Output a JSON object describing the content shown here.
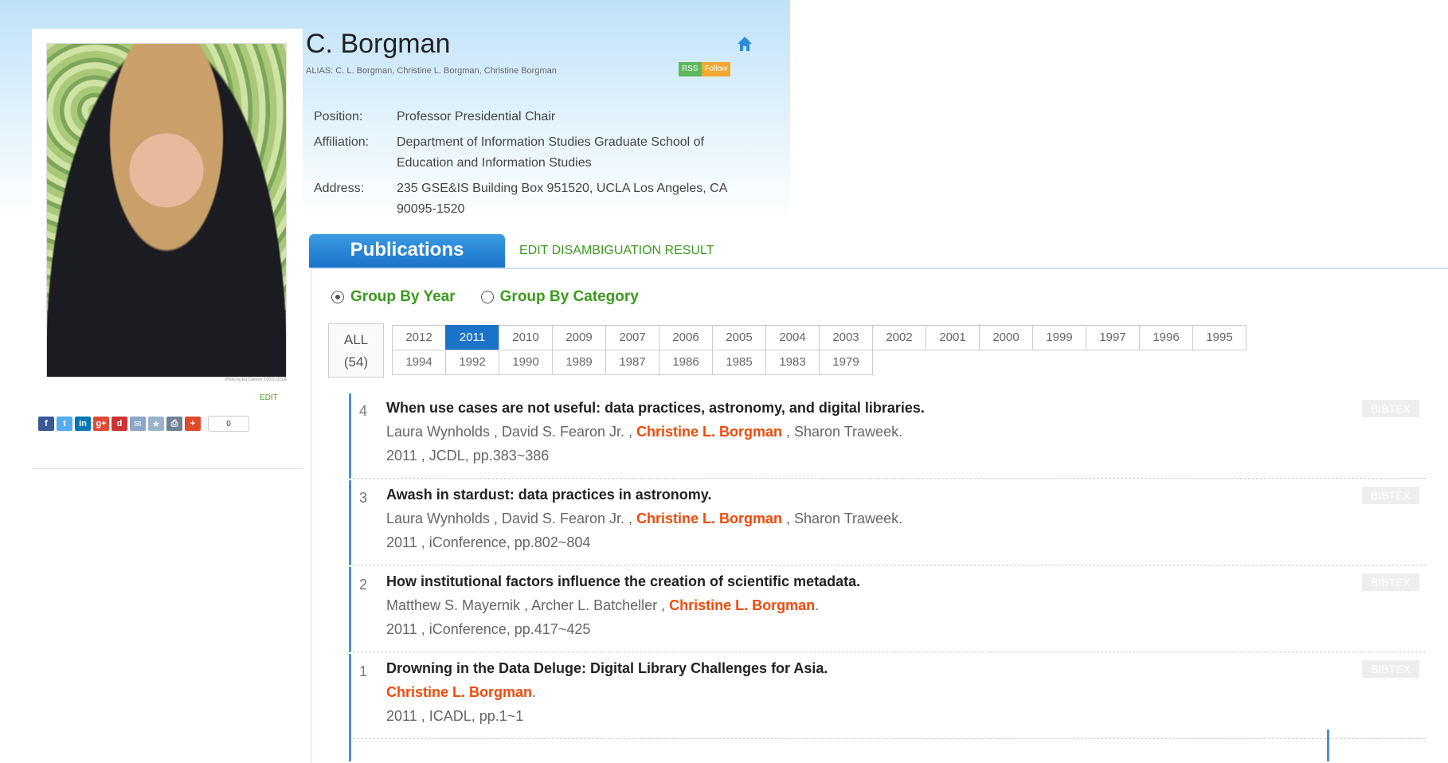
{
  "profile": {
    "name": "C. Borgman",
    "alias": "ALIAS: C. L. Borgman, Christine L. Borgman, Christine Borgman",
    "photo_credit": "Photo by Ed Carreon ©2011 UCLA",
    "edit_label": "EDIT",
    "badges": {
      "rss": "RSS",
      "follow": "Follow"
    },
    "position_label": "Position:",
    "position": "Professor Presidential Chair",
    "affiliation_label": "Affiliation:",
    "affiliation": "Department of Information Studies Graduate School of Education and Information Studies",
    "address_label": "Address:",
    "address": "235 GSE&IS Building Box 951520, UCLA Los Angeles, CA 90095-1520",
    "share_count": "0"
  },
  "share_icons": [
    {
      "icon": "facebook-icon",
      "glyph": "f",
      "color": "#3b5998"
    },
    {
      "icon": "twitter-icon",
      "glyph": "t",
      "color": "#55acee"
    },
    {
      "icon": "linkedin-icon",
      "glyph": "in",
      "color": "#0077b5"
    },
    {
      "icon": "google-plus-icon",
      "glyph": "g+",
      "color": "#dd4b39"
    },
    {
      "icon": "delicious-icon",
      "glyph": "d",
      "color": "#cc3333"
    },
    {
      "icon": "email-icon",
      "glyph": "✉",
      "color": "#8aa7c7"
    },
    {
      "icon": "bookmark-icon",
      "glyph": "★",
      "color": "#9bb3c9"
    },
    {
      "icon": "print-icon",
      "glyph": "⎙",
      "color": "#6f8194"
    },
    {
      "icon": "more-share-icon",
      "glyph": "+",
      "color": "#e04b2b"
    }
  ],
  "publications": {
    "tab_label": "Publications",
    "edit_disambiguation": "EDIT DISAMBIGUATION RESULT",
    "group_by_year": "Group By Year",
    "group_by_category": "Group By Category",
    "all_label": "ALL",
    "all_count": "(54)",
    "years_row1": [
      "2012",
      "2011",
      "2010",
      "2009",
      "2007",
      "2006",
      "2005",
      "2004",
      "2003",
      "2002",
      "2001",
      "2000",
      "1999",
      "1997",
      "1996",
      "1995"
    ],
    "years_row2": [
      "1994",
      "1992",
      "1990",
      "1989",
      "1987",
      "1986",
      "1985",
      "1983",
      "1979"
    ],
    "active_year": "2011",
    "bibtex_label": "BIBTEX",
    "items": [
      {
        "num": "4",
        "title": "When use cases are not useful: data practices, astronomy, and digital libraries.",
        "authors_before": "Laura Wynholds , David S. Fearon Jr. , ",
        "highlight": "Christine L. Borgman",
        "authors_after": " , Sharon Traweek.",
        "venue": "2011 , JCDL, pp.383~386"
      },
      {
        "num": "3",
        "title": "Awash in stardust: data practices in astronomy.",
        "authors_before": "Laura Wynholds , David S. Fearon Jr. , ",
        "highlight": "Christine L. Borgman",
        "authors_after": " , Sharon Traweek.",
        "venue": "2011 , iConference, pp.802~804"
      },
      {
        "num": "2",
        "title": "How institutional factors influence the creation of scientific metadata.",
        "authors_before": "Matthew S. Mayernik , Archer L. Batcheller , ",
        "highlight": "Christine L. Borgman",
        "authors_after": ".",
        "venue": "2011 , iConference, pp.417~425"
      },
      {
        "num": "1",
        "title": "Drowning in the Data Deluge: Digital Library Challenges for Asia.",
        "authors_before": "",
        "highlight": "Christine L. Borgman",
        "authors_after": ".",
        "venue": "2011 , ICADL, pp.1~1"
      }
    ]
  }
}
